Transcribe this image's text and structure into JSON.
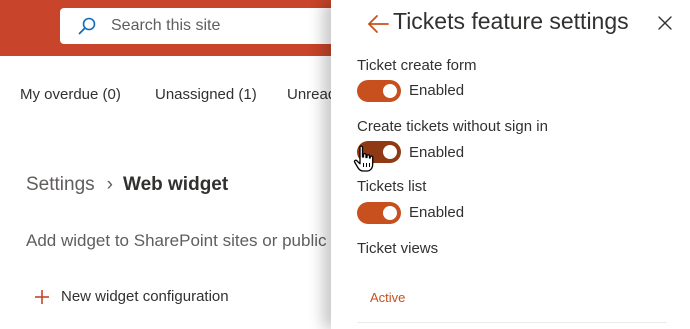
{
  "header": {
    "search_placeholder": "Search this site"
  },
  "filters": {
    "tabs": [
      {
        "label": "My overdue (0)"
      },
      {
        "label": "Unassigned (1)"
      },
      {
        "label": "Unread"
      }
    ]
  },
  "breadcrumb": {
    "root": "Settings",
    "separator": "›",
    "current": "Web widget"
  },
  "page": {
    "description": "Add widget to SharePoint sites or public",
    "new_button_label": "New widget configuration"
  },
  "panel": {
    "title": "Tickets feature settings",
    "settings": [
      {
        "label": "Ticket create form",
        "state": "Enabled",
        "on": true
      },
      {
        "label": "Create tickets without sign in",
        "state": "Enabled",
        "on": true
      },
      {
        "label": "Tickets list",
        "state": "Enabled",
        "on": true
      }
    ],
    "views_label": "Ticket views",
    "active_tab": "Active"
  },
  "colors": {
    "header": "#c8442a",
    "toggle_on": "#c8501e",
    "toggle_hover": "#8f3a14",
    "accent_text": "#c8501e"
  },
  "icons": {
    "search": "search-icon",
    "back": "arrow-left-icon",
    "close": "close-icon",
    "add": "plus-icon",
    "cursor": "hand-pointer-cursor-icon"
  }
}
